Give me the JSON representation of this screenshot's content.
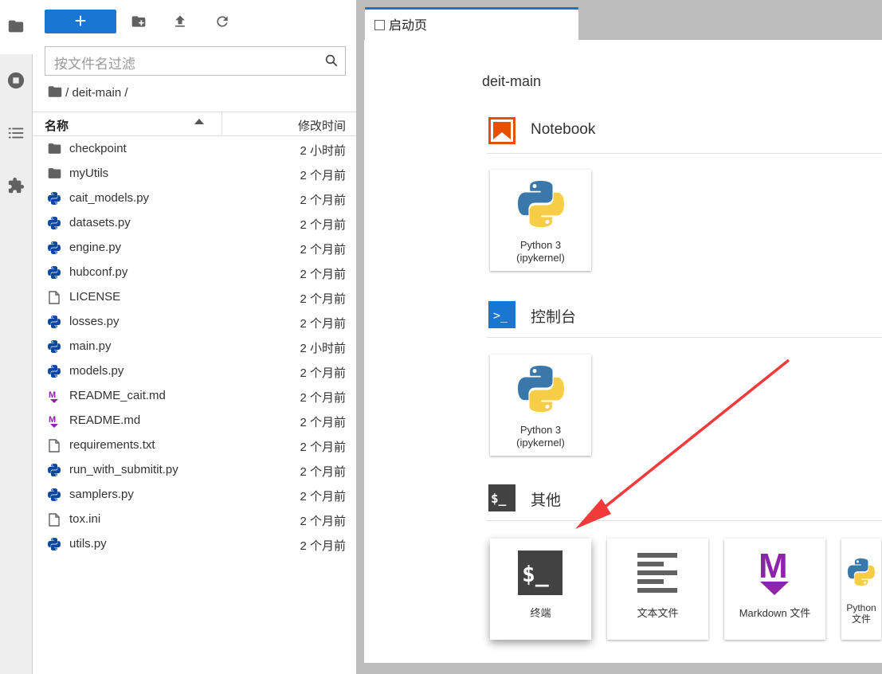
{
  "sidebar": {
    "icons": [
      "folder-icon",
      "running-icon",
      "toc-icon",
      "extension-icon"
    ]
  },
  "filebrowser": {
    "new_label": "+",
    "search_placeholder": "按文件名过滤",
    "breadcrumb": "/ deit-main /",
    "col_name": "名称",
    "col_modified": "修改时间",
    "files": [
      {
        "name": "checkpoint",
        "type": "folder",
        "modified": "2 小时前"
      },
      {
        "name": "myUtils",
        "type": "folder",
        "modified": "2 个月前"
      },
      {
        "name": "cait_models.py",
        "type": "python",
        "modified": "2 个月前"
      },
      {
        "name": "datasets.py",
        "type": "python",
        "modified": "2 个月前"
      },
      {
        "name": "engine.py",
        "type": "python",
        "modified": "2 个月前"
      },
      {
        "name": "hubconf.py",
        "type": "python",
        "modified": "2 个月前"
      },
      {
        "name": "LICENSE",
        "type": "file",
        "modified": "2 个月前"
      },
      {
        "name": "losses.py",
        "type": "python",
        "modified": "2 个月前"
      },
      {
        "name": "main.py",
        "type": "python",
        "modified": "2 小时前"
      },
      {
        "name": "models.py",
        "type": "python",
        "modified": "2 个月前"
      },
      {
        "name": "README_cait.md",
        "type": "markdown",
        "modified": "2 个月前"
      },
      {
        "name": "README.md",
        "type": "markdown",
        "modified": "2 个月前"
      },
      {
        "name": "requirements.txt",
        "type": "file",
        "modified": "2 个月前"
      },
      {
        "name": "run_with_submitit.py",
        "type": "python",
        "modified": "2 个月前"
      },
      {
        "name": "samplers.py",
        "type": "python",
        "modified": "2 个月前"
      },
      {
        "name": "tox.ini",
        "type": "file",
        "modified": "2 个月前"
      },
      {
        "name": "utils.py",
        "type": "python",
        "modified": "2 个月前"
      }
    ]
  },
  "tab": {
    "label": "启动页"
  },
  "launcher": {
    "cwd": "deit-main",
    "sections": [
      {
        "title": "Notebook",
        "cards": [
          {
            "label": "Python 3\n(ipykernel)"
          }
        ]
      },
      {
        "title": "控制台",
        "cards": [
          {
            "label": "Python 3\n(ipykernel)"
          }
        ]
      },
      {
        "title": "其他",
        "cards": [
          {
            "label": "终端"
          },
          {
            "label": "文本文件"
          },
          {
            "label": "Markdown 文件"
          },
          {
            "label": "Python 文件"
          }
        ]
      }
    ]
  },
  "colors": {
    "accent": "#1976d2",
    "notebook": "#e65100",
    "markdown": "#8e24aa",
    "arrow": "#f23a3a"
  }
}
